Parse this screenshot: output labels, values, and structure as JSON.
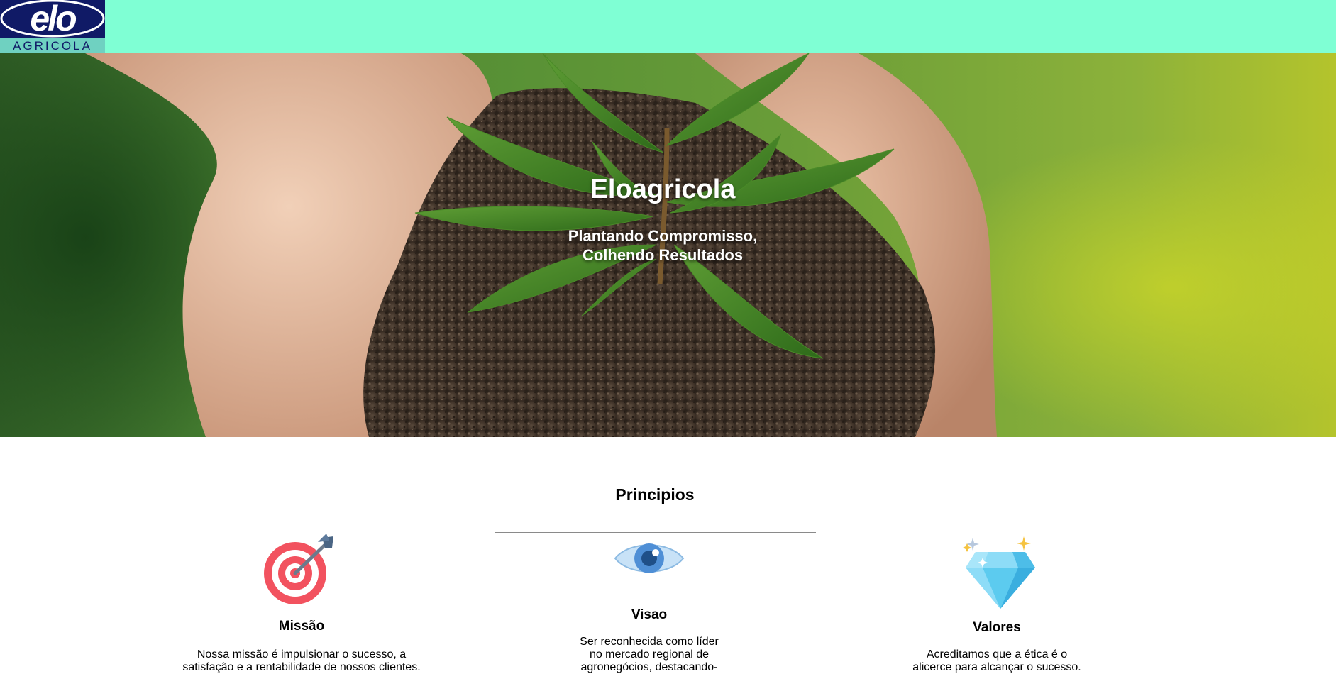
{
  "header": {
    "logo_text_top": "elo",
    "logo_text_bottom": "AGRICOLA",
    "background_color": "#7fffd4",
    "logo_color": "#101a66"
  },
  "hero": {
    "title": "Eloagricola",
    "subtitle_line1": "Plantando Compromisso,",
    "subtitle_line2": "Colhendo Resultados"
  },
  "principles": {
    "heading": "Principios",
    "cards": [
      {
        "icon": "target-arrow-icon",
        "title": "Missão",
        "text_line1": "Nossa missão é impulsionar o sucesso, a",
        "text_line2": "satisfação e a rentabilidade de nossos clientes."
      },
      {
        "icon": "eye-icon",
        "title": "Visao",
        "text_line1": "Ser reconhecida como líder",
        "text_line2": "no mercado regional de",
        "text_line3": "agronegócios, destacando-"
      },
      {
        "icon": "diamond-icon",
        "title": "Valores",
        "text_line1": "Acreditamos que a ética é o",
        "text_line2": "alicerce para alcançar o sucesso."
      }
    ]
  }
}
